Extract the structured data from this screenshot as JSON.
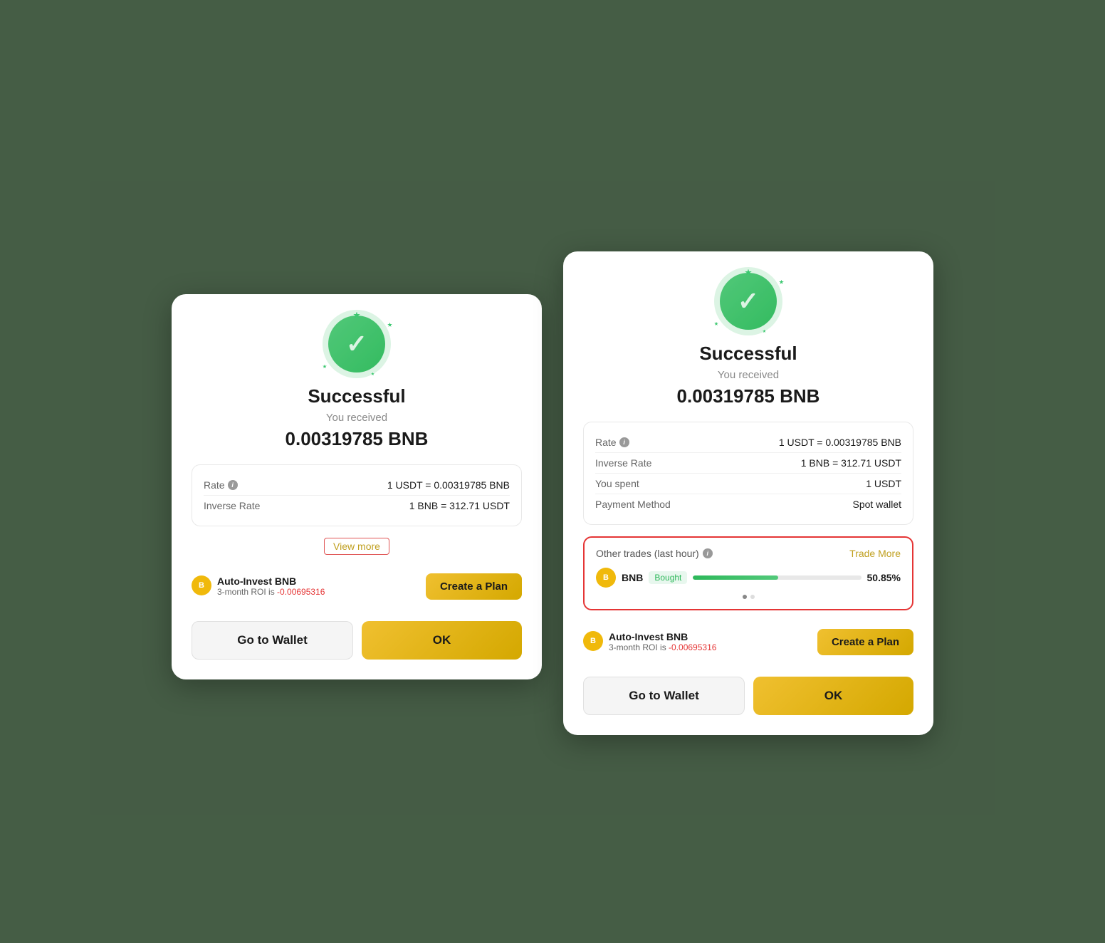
{
  "background": {
    "color": "#5a7a5a"
  },
  "dialog_left": {
    "title": "Successful",
    "you_received_label": "You received",
    "received_amount": "0.00319785 BNB",
    "rate_table": {
      "rows": [
        {
          "label": "Rate",
          "value": "1 USDT = 0.00319785 BNB",
          "has_info": true
        },
        {
          "label": "Inverse Rate",
          "value": "1 BNB = 312.71 USDT",
          "has_info": false
        }
      ]
    },
    "view_more_label": "View more",
    "auto_invest": {
      "name": "Auto-Invest BNB",
      "roi_label": "3-month ROI is",
      "roi_value": "-0.00695316",
      "create_plan_label": "Create a Plan"
    },
    "go_to_wallet_label": "Go to Wallet",
    "ok_label": "OK"
  },
  "dialog_right": {
    "title": "Successful",
    "you_received_label": "You received",
    "received_amount": "0.00319785 BNB",
    "rate_table": {
      "rows": [
        {
          "label": "Rate",
          "value": "1 USDT = 0.00319785 BNB",
          "has_info": true
        },
        {
          "label": "Inverse Rate",
          "value": "1 BNB = 312.71 USDT",
          "has_info": false
        },
        {
          "label": "You spent",
          "value": "1 USDT",
          "has_info": false
        },
        {
          "label": "Payment Method",
          "value": "Spot wallet",
          "has_info": false
        }
      ]
    },
    "other_trades": {
      "title": "Other trades (last hour)",
      "trade_more_label": "Trade More",
      "coin_label": "BNB",
      "bought_label": "Bought",
      "progress_percent": 50.85,
      "percent_label": "50.85%"
    },
    "auto_invest": {
      "name": "Auto-Invest BNB",
      "roi_label": "3-month ROI is",
      "roi_value": "-0.00695316",
      "create_plan_label": "Create a Plan"
    },
    "go_to_wallet_label": "Go to Wallet",
    "ok_label": "OK"
  }
}
